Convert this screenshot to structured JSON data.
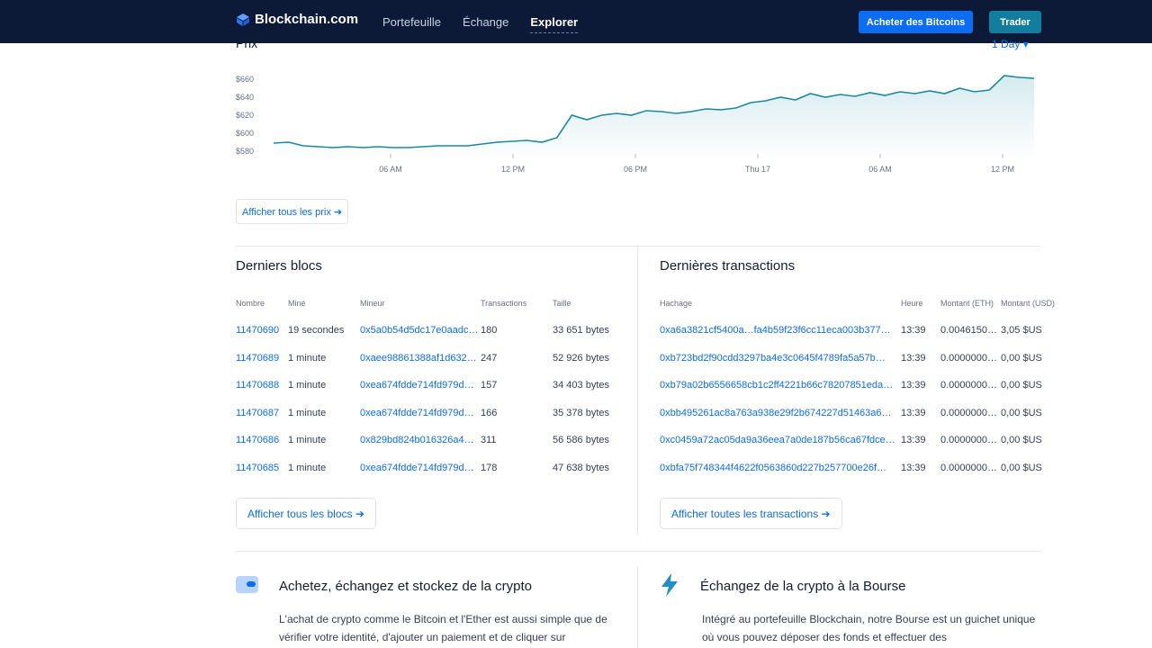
{
  "header": {
    "brand": "Blockchain.com",
    "nav": [
      "Portefeuille",
      "Échange",
      "Explorer"
    ],
    "active_nav": "Explorer",
    "buy_label": "Acheter des Bitcoins",
    "trade_label": "Trader",
    "colors": {
      "background": "#0c1a37",
      "buy": "#0c6cf2",
      "trade": "#137d9e"
    }
  },
  "price": {
    "title": "Prix",
    "range": "1 Day",
    "view_all": "Afficher tous les prix ➔"
  },
  "chart_data": {
    "type": "area",
    "title": "",
    "xlabel": "",
    "ylabel": "",
    "y_ticks": [
      "$580",
      "$600",
      "$620",
      "$640",
      "$660"
    ],
    "x_ticks": [
      "06 AM",
      "12 PM",
      "06 PM",
      "Thu 17",
      "06 AM",
      "12 PM"
    ],
    "ylim": [
      570,
      670
    ],
    "grid": false,
    "color": "#1a8aa0",
    "series": [
      {
        "values": [
          589,
          590,
          586,
          585,
          584,
          585,
          584,
          585,
          584,
          584,
          585,
          586,
          586,
          586,
          588,
          590,
          591,
          592,
          590,
          595,
          620,
          615,
          620,
          622,
          620,
          625,
          624,
          622,
          624,
          627,
          626,
          628,
          634,
          636,
          640,
          637,
          644,
          640,
          643,
          641,
          645,
          642,
          646,
          644,
          647,
          644,
          650,
          646,
          648,
          664,
          662,
          661
        ]
      }
    ]
  },
  "blocks": {
    "title": "Derniers blocs",
    "columns": [
      "Nombre",
      "Miné",
      "Mineur",
      "Transactions",
      "Taille"
    ],
    "rows": [
      [
        "11470690",
        "19 secondes",
        "0x5a0b54d5dc17e0aadc…",
        "180",
        "33 651 bytes"
      ],
      [
        "11470689",
        "1 minute",
        "0xaee98861388af1d632…",
        "247",
        "52 926 bytes"
      ],
      [
        "11470688",
        "1 minute",
        "0xea674fdde714fd979d…",
        "157",
        "34 403 bytes"
      ],
      [
        "11470687",
        "1 minute",
        "0xea674fdde714fd979d…",
        "166",
        "35 378 bytes"
      ],
      [
        "11470686",
        "1 minute",
        "0x829bd824b016326a4…",
        "311",
        "56 586 bytes"
      ],
      [
        "11470685",
        "1 minute",
        "0xea674fdde714fd979d…",
        "178",
        "47 638 bytes"
      ]
    ],
    "view_all": "Afficher tous les blocs ➔"
  },
  "transactions": {
    "title": "Dernières transactions",
    "columns": [
      "Hachage",
      "Heure",
      "Montant (ETH)",
      "Montant (USD)"
    ],
    "rows": [
      [
        "0xa6a3821cf5400a…fa4b59f23f6cc11eca003b377…",
        "13:39",
        "0.0046150…",
        "3,05 $US"
      ],
      [
        "0xb723bd2f90cdd3297ba4e3c0645f4789fa5a57b…",
        "13:39",
        "0.0000000…",
        "0,00 $US"
      ],
      [
        "0xb79a02b6556658cb1c2ff4221b66c78207851eda…",
        "13:39",
        "0.0000000…",
        "0,00 $US"
      ],
      [
        "0xbb495261ac8a763a938e29f2b674227d51463a6…",
        "13:39",
        "0.0000000…",
        "0,00 $US"
      ],
      [
        "0xc0459a72ac05da9a36eea7a0de187b56ca67fdce…",
        "13:39",
        "0.0000000…",
        "0,00 $US"
      ],
      [
        "0xbfa75f748344f4622f0563860d227b257700e26f…",
        "13:39",
        "0.0000000…",
        "0,00 $US"
      ]
    ],
    "view_all": "Afficher toutes les transactions ➔"
  },
  "promo": {
    "left_title": "Achetez, échangez et stockez de la crypto",
    "left_text": "L'achat de crypto comme le Bitcoin et l'Ether est aussi simple que de vérifier votre identité, d'ajouter un paiement et de cliquer sur",
    "right_title": "Échangez de la crypto à la Bourse",
    "right_text": "Intégré au portefeuille Blockchain, notre Bourse est un guichet unique où vous pouvez déposer des fonds et effectuer des"
  }
}
